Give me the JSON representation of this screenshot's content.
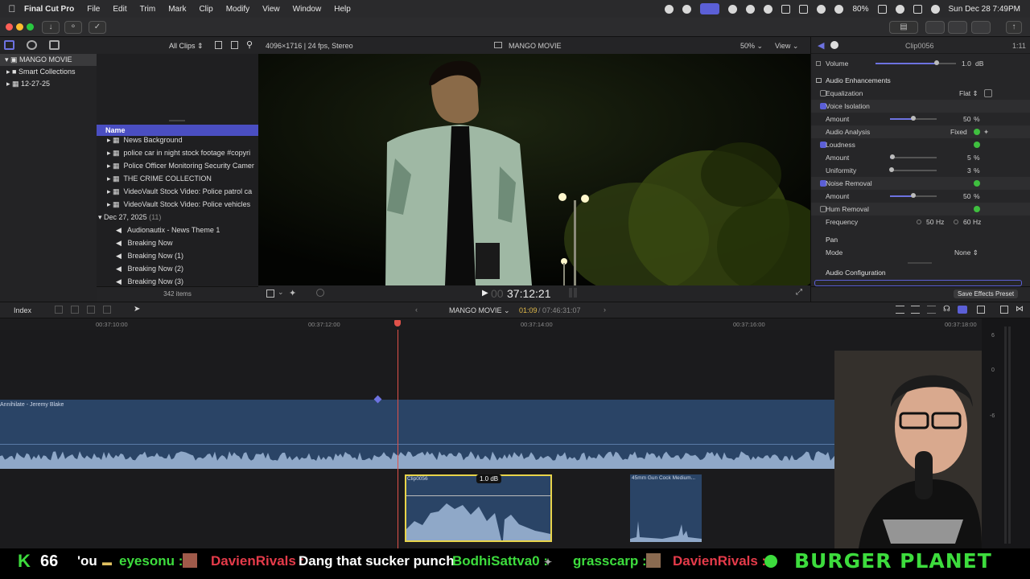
{
  "menubar": {
    "app": "Final Cut Pro",
    "items": [
      "File",
      "Edit",
      "Trim",
      "Mark",
      "Clip",
      "Modify",
      "View",
      "Window",
      "Help"
    ],
    "battery": "80%",
    "datetime": "Sun Dec 28  7:49PM"
  },
  "library": {
    "items": [
      "MANGO MOVIE",
      "Smart Collections",
      "12-27-25"
    ]
  },
  "browser": {
    "filter": "All Clips",
    "column_name": "Name",
    "rows": [
      "News Background",
      "police  car in night stock footage #copyri",
      "Police Officer Monitoring Security Camer",
      "THE CRIME COLLECTION",
      "VideoVault Stock Video:   Police patrol ca",
      "VideoVault Stock Video:   Police vehicles"
    ],
    "date_group": "Dec 27, 2025",
    "date_group_count": "(11)",
    "audio_rows": [
      "Audionautix - News Theme 1",
      "Breaking Now",
      "Breaking Now (1)",
      "Breaking Now (2)",
      "Breaking Now (3)"
    ],
    "item_count": "342 items"
  },
  "viewer": {
    "format": "4096×1716 | 24 fps, Stereo",
    "project": "MANGO MOVIE",
    "zoom": "50%",
    "view_menu": "View",
    "timecode": "37:12:21",
    "timecode_prefix": "00"
  },
  "inspector": {
    "clip": "Clip0056",
    "duration": "1:11",
    "volume_label": "Volume",
    "volume_value": "1.0",
    "volume_unit": "dB",
    "volume_level": 0.76,
    "section_enh": "Audio Enhancements",
    "eq_label": "Equalization",
    "eq_value": "Flat",
    "voice_iso": "Voice Isolation",
    "vi_amount_label": "Amount",
    "vi_amount": "50",
    "vi_amount_level": 0.5,
    "analysis_label": "Audio Analysis",
    "analysis_value": "Fixed",
    "loudness": "Loudness",
    "loud_amount_label": "Amount",
    "loud_amount": "5",
    "loud_amount_level": 0.05,
    "uniformity_label": "Uniformity",
    "uniformity": "3",
    "uniformity_level": 0.03,
    "noise": "Noise Removal",
    "noise_amount_label": "Amount",
    "noise_amount": "50",
    "noise_amount_level": 0.5,
    "hum": "Hum Removal",
    "freq_label": "Frequency",
    "freq_50": "50",
    "freq_60": "60",
    "hz": "Hz",
    "pct": "%",
    "pan": "Pan",
    "mode_label": "Mode",
    "mode_value": "None",
    "audio_config": "Audio Configuration",
    "save_preset": "Save Effects Preset"
  },
  "timeline": {
    "index": "Index",
    "project": "MANGO MOVIE",
    "position": "01:09",
    "total": "07:46:31:07",
    "ruler": [
      "00:37:10:00",
      "00:37:12:00",
      "00:37:14:00",
      "00:37:16:00",
      "00:37:18:00"
    ],
    "music_clip": "Annihilate - Jeremy Blake",
    "clip1": "Clip0056",
    "clip1_gain": "1.0 dB",
    "clip2": "45mm Gun Cock Medium...",
    "meter_labels": [
      "6",
      "0",
      "-6"
    ]
  },
  "ticker": {
    "count": "66",
    "prefix": "'ou",
    "user1": "eyesonu :",
    "user2": "DavienRivals :",
    "msg2": "Dang that sucker punch",
    "user3": "BodhiSattva0 :",
    "user4": "grasscarp :",
    "user5": "DavienRivals :",
    "brand": "BURGER  PLANET"
  }
}
